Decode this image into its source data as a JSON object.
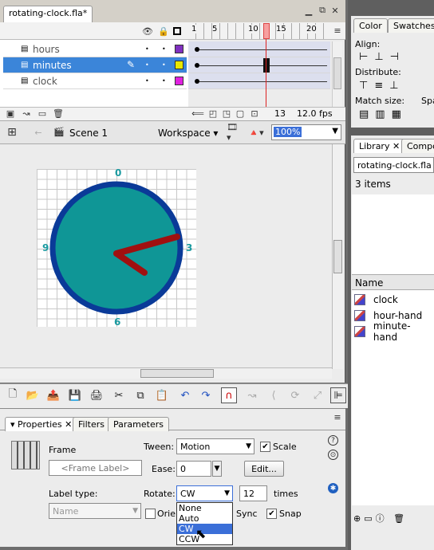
{
  "document_tab": "rotating-clock.fla*",
  "timeline": {
    "ruler": [
      "1",
      "5",
      "10",
      "15",
      "20"
    ],
    "layers": [
      {
        "name": "hours",
        "color": "#8030c0",
        "selected": false
      },
      {
        "name": "minutes",
        "color": "#e8e800",
        "selected": true
      },
      {
        "name": "clock",
        "color": "#e020e0",
        "selected": false
      }
    ],
    "current_frame": "13",
    "fps": "12.0 fps"
  },
  "edit_bar": {
    "scene": "Scene 1",
    "workspace": "Workspace",
    "zoom": "100%"
  },
  "stage": {
    "labels": {
      "top": "0",
      "right": "3",
      "bottom": "6",
      "left": "9"
    },
    "colors": {
      "face": "#0f9696",
      "rim": "#0a3a98",
      "hands": "#a01010",
      "label": "#1a9aa0"
    }
  },
  "properties": {
    "tabs": [
      "Properties",
      "Filters",
      "Parameters"
    ],
    "frame_title": "Frame",
    "frame_label_placeholder": "<Frame Label>",
    "label_type": "Label type:",
    "label_type_value": "Name",
    "tween_label": "Tween:",
    "tween_value": "Motion",
    "scale_label": "Scale",
    "ease_label": "Ease:",
    "ease_value": "0",
    "edit_button": "Edit...",
    "rotate_label": "Rotate:",
    "rotate_value": "CW",
    "times_value": "12",
    "times_label": "times",
    "orient_label": "Orien",
    "sync_label": "Sync",
    "snap_label": "Snap",
    "rotate_options": [
      "None",
      "Auto",
      "CW",
      "CCW"
    ]
  },
  "right_panel": {
    "top_tabs": [
      "Color",
      "Swatches"
    ],
    "align_label": "Align:",
    "distribute_label": "Distribute:",
    "match_size_label": "Match size:",
    "spacing_label": "Spa",
    "library_tabs": [
      "Library",
      "Compo"
    ],
    "library_file": "rotating-clock.fla",
    "item_count": "3 items",
    "name_header": "Name",
    "items": [
      "clock",
      "hour-hand",
      "minute-hand"
    ]
  }
}
